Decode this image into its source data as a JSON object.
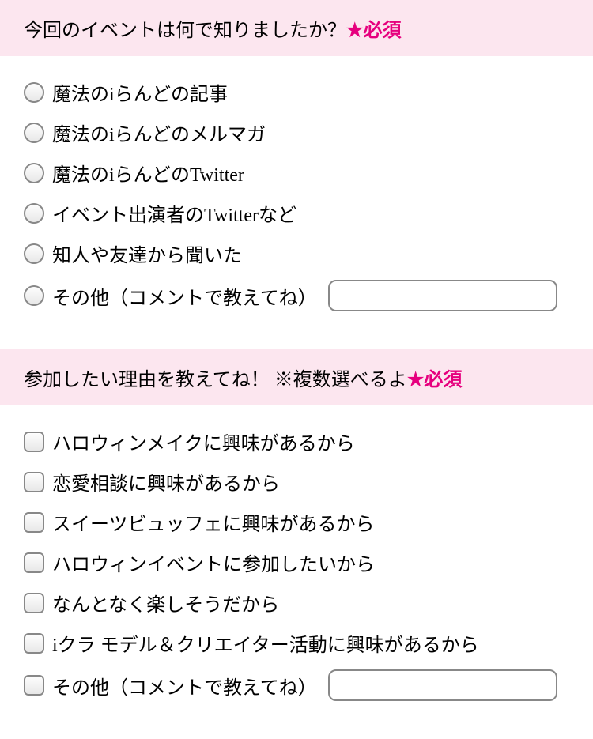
{
  "required_label": "★必須",
  "q1": {
    "title": "今回のイベントは何で知りましたか？",
    "options": [
      "魔法のiらんどの記事",
      "魔法のiらんどのメルマガ",
      "魔法のiらんどのTwitter",
      "イベント出演者のTwitterなど",
      "知人や友達から聞いた",
      "その他（コメントで教えてね）"
    ]
  },
  "q2": {
    "title": "参加したい理由を教えてね！ ※複数選べるよ",
    "options": [
      "ハロウィンメイクに興味があるから",
      "恋愛相談に興味があるから",
      "スイーツビュッフェに興味があるから",
      "ハロウィンイベントに参加したいから",
      "なんとなく楽しそうだから",
      "iクラ モデル＆クリエイター活動に興味があるから",
      "その他（コメントで教えてね）"
    ]
  }
}
